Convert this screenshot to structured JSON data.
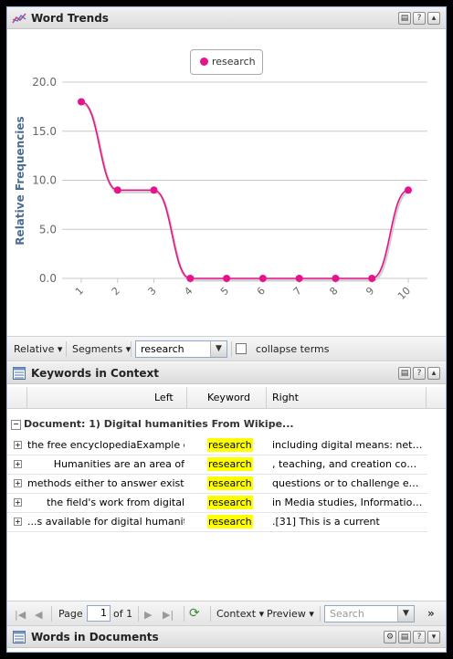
{
  "word_trends": {
    "title": "Word Trends",
    "legend": "research",
    "y_axis_label": "Relative Frequencies",
    "toolbar": {
      "relative_label": "Relative",
      "segments_label": "Segments",
      "term_value": "research",
      "collapse_label": "collapse terms"
    }
  },
  "chart_data": {
    "type": "line",
    "x": [
      "1",
      "2",
      "3",
      "4",
      "5",
      "6",
      "7",
      "8",
      "9",
      "10"
    ],
    "series": [
      {
        "name": "research",
        "values": [
          18.0,
          9.0,
          9.0,
          0.0,
          0.0,
          0.0,
          0.0,
          0.0,
          0.0,
          9.0
        ],
        "color": "#e6148c"
      }
    ],
    "ylabel": "Relative Frequencies",
    "y_ticks": [
      "0.0",
      "5.0",
      "10.0",
      "15.0",
      "20.0"
    ],
    "ylim": [
      0,
      20
    ],
    "legend_position": "top"
  },
  "kwic": {
    "title": "Keywords in Context",
    "columns": {
      "left": "Left",
      "keyword": "Keyword",
      "right": "Right"
    },
    "group_label": "Document: 1) Digital humanities From Wikipe...",
    "rows": [
      {
        "left": "the free encyclopediaExample of",
        "keyword": "research",
        "right": "including digital means: network..."
      },
      {
        "left": "Humanities are an area of",
        "keyword": "research",
        "right": ", teaching, and creation concer..."
      },
      {
        "left": "methods either to answer existing",
        "keyword": "research",
        "right": "questions or to challenge existing"
      },
      {
        "left": "the field's work from digital",
        "keyword": "research",
        "right": "in Media studies, Information stu..."
      },
      {
        "left": "...s available for digital humanities",
        "keyword": "research",
        "right": ".[31] This is a current"
      }
    ],
    "pager": {
      "page_label": "Page",
      "page_value": "1",
      "of_label": "of 1",
      "context_label": "Context",
      "preview_label": "Preview",
      "search_placeholder": "Search"
    }
  },
  "words_in_documents": {
    "title": "Words in Documents"
  }
}
